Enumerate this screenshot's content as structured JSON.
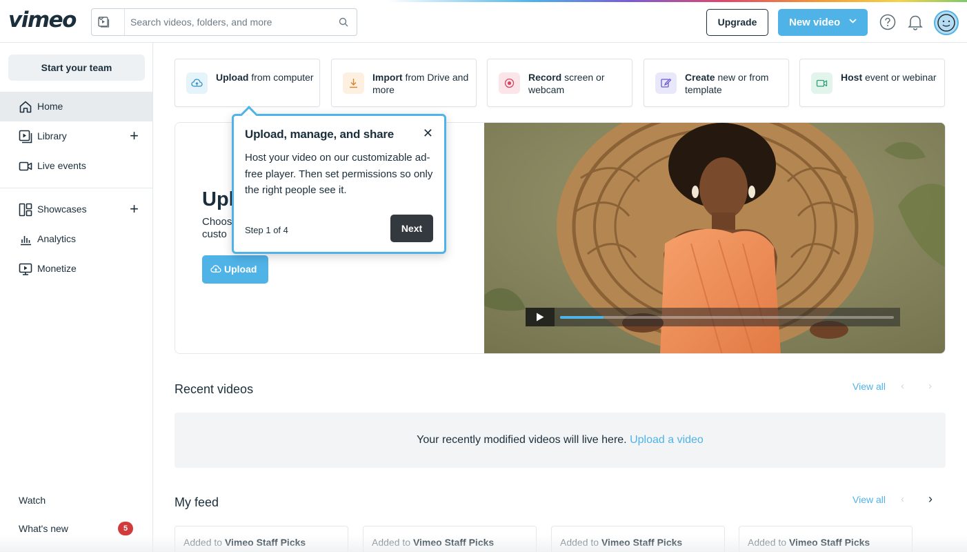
{
  "app": {
    "logo": "vimeo"
  },
  "search": {
    "placeholder": "Search videos, folders, and more"
  },
  "header": {
    "upgrade_label": "Upgrade",
    "new_video_label": "New video"
  },
  "sidebar": {
    "start_team_label": "Start your team",
    "items": [
      {
        "label": "Home",
        "icon": "home-icon",
        "active": true
      },
      {
        "label": "Library",
        "icon": "library-icon",
        "has_add": true
      },
      {
        "label": "Live events",
        "icon": "live-events-icon"
      },
      {
        "label": "Showcases",
        "icon": "showcases-icon",
        "has_add": true
      },
      {
        "label": "Analytics",
        "icon": "analytics-icon"
      },
      {
        "label": "Monetize",
        "icon": "monetize-icon"
      }
    ],
    "watch_label": "Watch",
    "whats_new_label": "What's new",
    "whats_new_count": "5"
  },
  "quick_actions": [
    {
      "bold": "Upload",
      "rest": " from computer",
      "icon": "cloud-upload-icon",
      "color": "#e5f3fb"
    },
    {
      "bold": "Import",
      "rest": " from Drive and more",
      "icon": "import-download-icon",
      "color": "#fdf0e1"
    },
    {
      "bold": "Record",
      "rest": " screen or webcam",
      "icon": "record-icon",
      "color": "#fbe5e8"
    },
    {
      "bold": "Create",
      "rest": " new or from template",
      "icon": "create-edit-icon",
      "color": "#e9e8fb"
    },
    {
      "bold": "Host",
      "rest": " event or webinar",
      "icon": "camera-icon",
      "color": "#e2f5ed"
    }
  ],
  "hero": {
    "title_partial": "Upl",
    "subtitle_line1": "Choos",
    "subtitle_line2": "custo",
    "upload_label": "Upload",
    "video_progress": 0.13
  },
  "tooltip": {
    "title": "Upload, manage, and share",
    "body": "Host your video on our customizable ad-free player. Then set permissions so only the right people see it.",
    "step": "Step 1 of 4",
    "next_label": "Next"
  },
  "recent": {
    "title": "Recent videos",
    "view_all": "View all",
    "empty_text": "Your recently modified videos will live here.",
    "empty_link": "Upload a video"
  },
  "feed": {
    "title": "My feed",
    "view_all": "View all",
    "cards": [
      {
        "prefix": "Added to ",
        "channel": "Vimeo Staff Picks"
      },
      {
        "prefix": "Added to ",
        "channel": "Vimeo Staff Picks"
      },
      {
        "prefix": "Added to ",
        "channel": "Vimeo Staff Picks"
      },
      {
        "prefix": "Added to ",
        "channel": "Vimeo Staff Picks"
      }
    ]
  },
  "colors": {
    "accent": "#4fb3e8",
    "text": "#1a2e3b",
    "badge": "#d23b3b"
  }
}
